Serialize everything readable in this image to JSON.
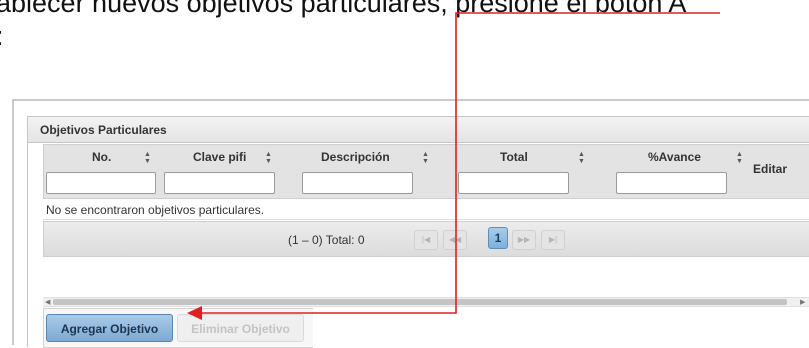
{
  "instruction": {
    "line1": "ablecer nuevos objetivos particulares, presione el botón A",
    "line2": ":"
  },
  "panel": {
    "title": "Objetivos Particulares"
  },
  "table": {
    "columns": [
      {
        "label": "No.",
        "sortable": true,
        "filterable": true,
        "filter_value": ""
      },
      {
        "label": "Clave pifi",
        "sortable": true,
        "filterable": true,
        "filter_value": ""
      },
      {
        "label": "Descripción",
        "sortable": true,
        "filterable": true,
        "filter_value": ""
      },
      {
        "label": "Total",
        "sortable": true,
        "filterable": true,
        "filter_value": ""
      },
      {
        "label": "%Avance",
        "sortable": true,
        "filterable": true,
        "filter_value": ""
      },
      {
        "label": "Editar",
        "sortable": false,
        "filterable": false
      }
    ],
    "empty_message": "No se encontraron objetivos particulares."
  },
  "paginator": {
    "report": "(1 – 0) Total: 0",
    "current_page": "1",
    "first_icon": "first-page-icon",
    "prev_icon": "prev-page-icon",
    "next_icon": "next-page-icon",
    "last_icon": "last-page-icon"
  },
  "buttons": {
    "add_label": "Agregar Objetivo",
    "delete_label": "Eliminar Objetivo"
  },
  "colors": {
    "annotation_arrow": "#e02020",
    "primary_button": "#8fb7de",
    "header_bg": "#e3e3e3"
  },
  "icons": {
    "sort": "sort-icon",
    "scroll_left": "scroll-left-icon",
    "scroll_right": "scroll-right-icon"
  }
}
